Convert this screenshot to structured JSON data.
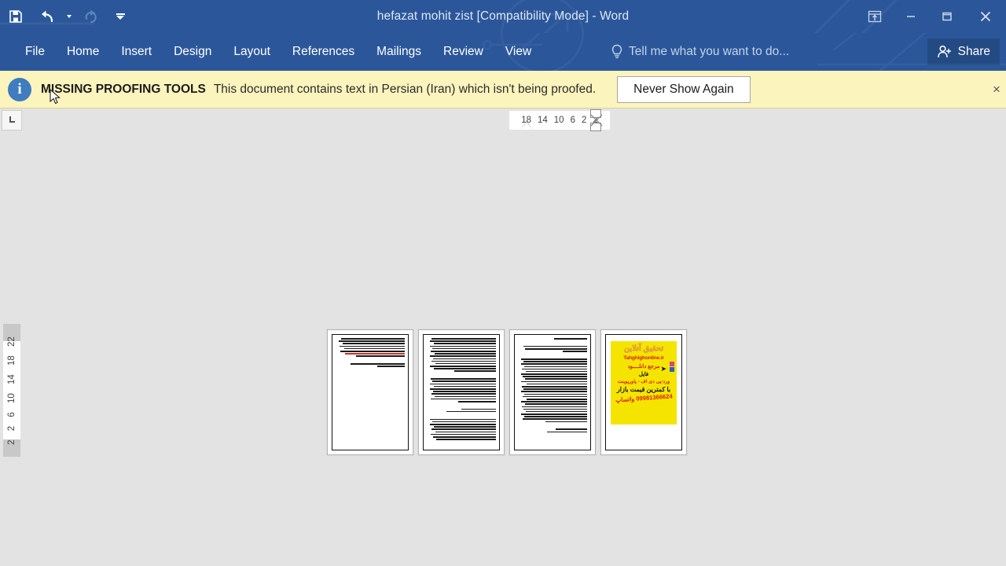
{
  "window": {
    "title": "hefazat mohit zist [Compatibility Mode] - Word",
    "accent_color": "#2b579a",
    "controls": {
      "ribbon_display_options": "Ribbon Display Options",
      "minimize": "Minimize",
      "maximize": "Maximize",
      "close": "Close"
    }
  },
  "quick_access": {
    "save": "Save",
    "undo": "Undo",
    "undo_dropdown": "Undo dropdown",
    "redo": "Redo",
    "customize": "Customize Quick Access Toolbar"
  },
  "ribbon": {
    "tabs": [
      {
        "label": "File"
      },
      {
        "label": "Home"
      },
      {
        "label": "Insert"
      },
      {
        "label": "Design"
      },
      {
        "label": "Layout"
      },
      {
        "label": "References"
      },
      {
        "label": "Mailings"
      },
      {
        "label": "Review"
      },
      {
        "label": "View"
      }
    ],
    "tell_me": "Tell me what you want to do...",
    "share": "Share"
  },
  "message_bar": {
    "icon": "info-icon",
    "glyph": "i",
    "title": "MISSING PROOFING TOOLS",
    "body": "This document contains text in Persian (Iran) which isn't being proofed.",
    "button": "Never Show Again",
    "close": "×",
    "background_color": "#fbf4bd"
  },
  "rulers": {
    "tab_selector": "L",
    "horizontal_numbers": [
      "18",
      "14",
      "10",
      "6",
      "2",
      "2"
    ],
    "vertical_numbers": [
      "2",
      "2",
      "6",
      "10",
      "14",
      "18",
      "22"
    ]
  },
  "document": {
    "zoom_view": "multiple-pages",
    "pages": [
      {
        "index": 1,
        "type": "text",
        "paragraphs": [
          {
            "lines": [
              92,
              96,
              90,
              94,
              88,
              93,
              86,
              70
            ],
            "highlight_index": 6
          },
          {
            "lines": [
              78,
              40
            ]
          }
        ]
      },
      {
        "index": 2,
        "type": "text",
        "paragraphs": [
          {
            "lines": [
              93,
              95,
              90,
              96,
              92,
              94,
              89,
              95,
              91,
              93,
              88,
              96,
              90,
              60
            ]
          },
          {
            "lines": [
              94,
              92,
              96,
              90,
              95,
              91,
              93,
              89,
              94,
              55
            ]
          },
          {
            "lines": [
              50,
              72
            ]
          },
          {
            "lines": [
              95,
              92,
              96,
              90,
              93,
              88,
              94,
              91,
              86
            ]
          }
        ]
      },
      {
        "index": 3,
        "type": "text",
        "paragraphs": [
          {
            "lines": [
              48
            ]
          },
          {
            "lines": [
              92,
              90,
              35
            ]
          },
          {
            "lines": [
              95,
              92,
              96,
              91,
              94,
              89,
              96,
              93,
              90,
              95,
              88,
              94,
              92,
              96,
              91,
              93,
              87,
              95,
              90,
              94,
              92,
              89,
              96,
              91,
              93,
              60
            ]
          },
          {
            "lines": [
              46,
              58
            ]
          }
        ]
      },
      {
        "index": 4,
        "type": "advertisement",
        "ad": {
          "background_color": "#f5e400",
          "title": "تحقیق آنلاین",
          "url": "Tahghighonline.ir",
          "line1": "مرجع دانلــــود",
          "line2": "فایل",
          "line3": "ورد-پی دی اف - پاورپوینت",
          "line4": "با کمترین قیمت بازار",
          "line5": "09981366624 واتساپ"
        }
      }
    ]
  },
  "canvas": {
    "background_color": "#e3e3e3"
  }
}
